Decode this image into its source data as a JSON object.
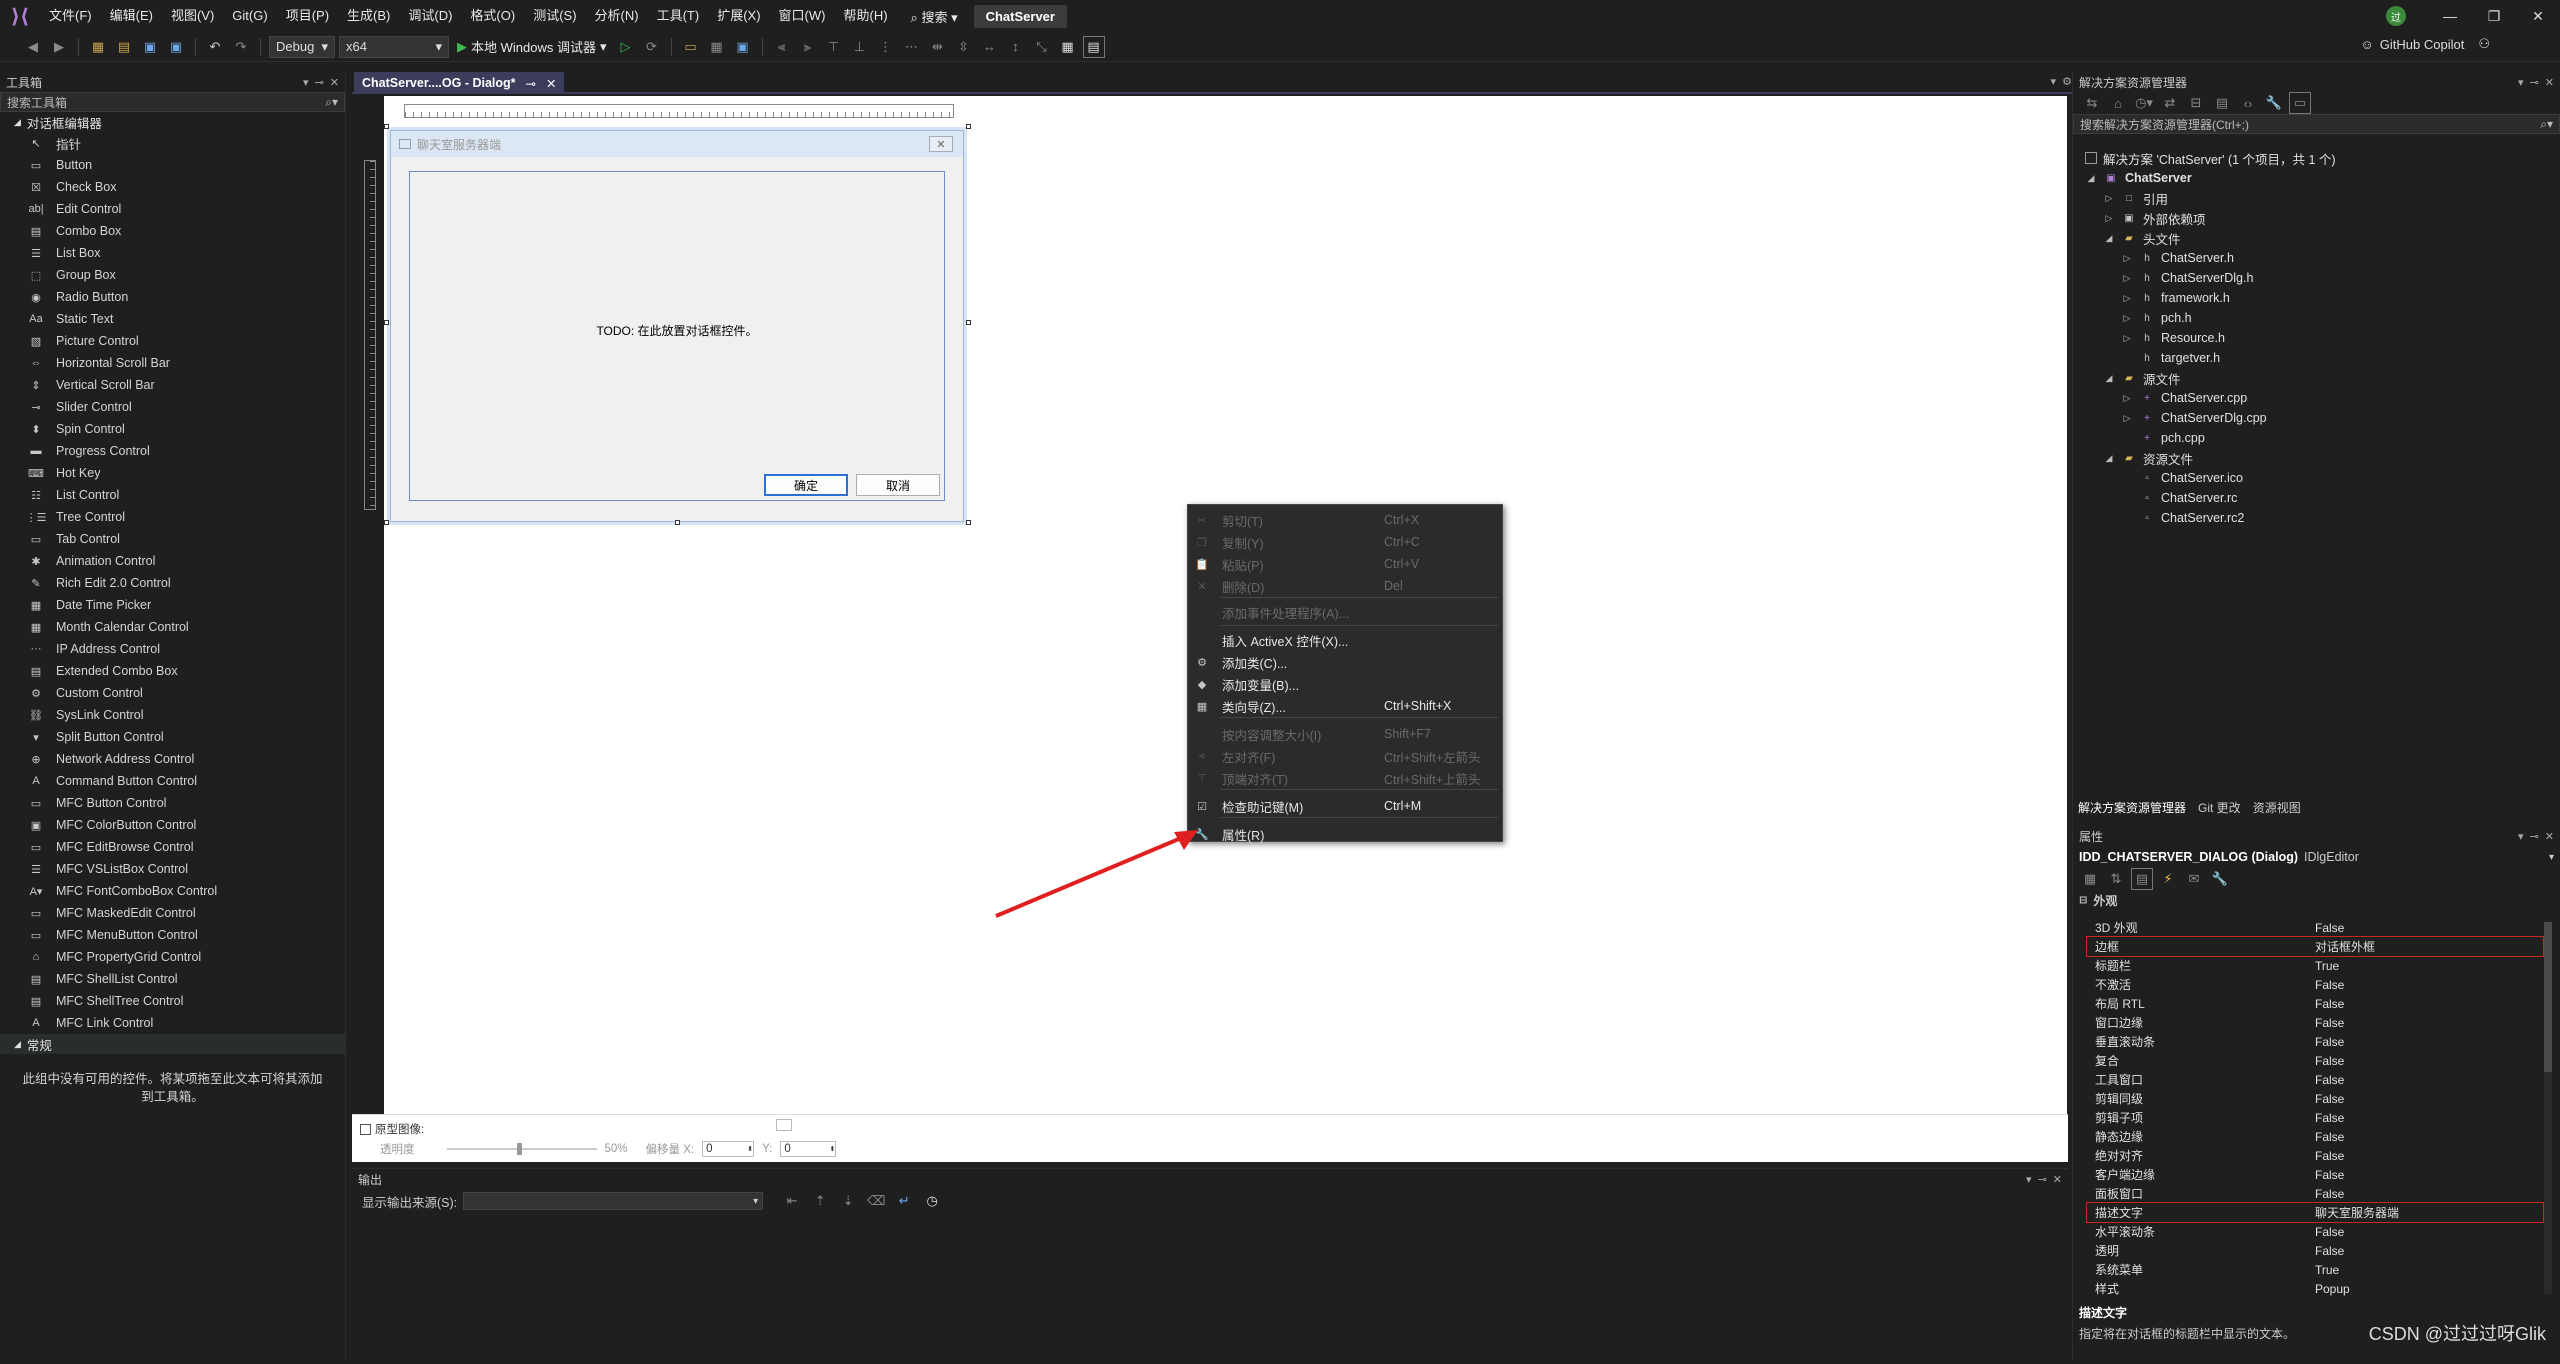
{
  "menubar": {
    "items": [
      "文件(F)",
      "编辑(E)",
      "视图(V)",
      "Git(G)",
      "项目(P)",
      "生成(B)",
      "调试(D)",
      "格式(O)",
      "测试(S)",
      "分析(N)",
      "工具(T)",
      "扩展(X)",
      "窗口(W)",
      "帮助(H)"
    ],
    "search": "搜索",
    "solution_name": "ChatServer",
    "avatar": "过",
    "window_controls": [
      "minimize-icon",
      "restore-icon",
      "close-icon"
    ]
  },
  "toolbar": {
    "config": "Debug",
    "platform": "x64",
    "run_label": "本地 Windows 调试器",
    "copilot": "GitHub Copilot"
  },
  "toolbox": {
    "title": "工具箱",
    "search_placeholder": "搜索工具箱",
    "category": "对话框编辑器",
    "items": [
      "指针",
      "Button",
      "Check Box",
      "Edit Control",
      "Combo Box",
      "List Box",
      "Group Box",
      "Radio Button",
      "Static Text",
      "Picture Control",
      "Horizontal Scroll Bar",
      "Vertical Scroll Bar",
      "Slider Control",
      "Spin Control",
      "Progress Control",
      "Hot Key",
      "List Control",
      "Tree Control",
      "Tab Control",
      "Animation Control",
      "Rich Edit 2.0 Control",
      "Date Time Picker",
      "Month Calendar Control",
      "IP Address Control",
      "Extended Combo Box",
      "Custom Control",
      "SysLink Control",
      "Split Button Control",
      "Network Address Control",
      "Command Button Control",
      "MFC Button Control",
      "MFC ColorButton Control",
      "MFC EditBrowse Control",
      "MFC VSListBox Control",
      "MFC FontComboBox Control",
      "MFC MaskedEdit Control",
      "MFC MenuButton Control",
      "MFC PropertyGrid Control",
      "MFC ShellList Control",
      "MFC ShellTree Control",
      "MFC Link Control"
    ],
    "general_category": "常规",
    "general_note": "此组中没有可用的控件。将某项拖至此文本可将其添加到工具箱。"
  },
  "editor": {
    "tab_label": "ChatServer....OG - Dialog*",
    "dialog_caption": "聊天室服务器端",
    "todo_text": "TODO: 在此放置对话框控件。",
    "ok_label": "确定",
    "cancel_label": "取消"
  },
  "context_menu": {
    "items": [
      {
        "label": "剪切(T)",
        "shortcut": "Ctrl+X",
        "enabled": false,
        "icon": "cut-icon"
      },
      {
        "label": "复制(Y)",
        "shortcut": "Ctrl+C",
        "enabled": false,
        "icon": "copy-icon"
      },
      {
        "label": "粘贴(P)",
        "shortcut": "Ctrl+V",
        "enabled": false,
        "icon": "paste-icon"
      },
      {
        "label": "删除(D)",
        "shortcut": "Del",
        "enabled": false,
        "icon": "delete-icon"
      },
      {
        "label": "添加事件处理程序(A)...",
        "shortcut": "",
        "enabled": false,
        "icon": ""
      },
      {
        "label": "插入 ActiveX 控件(X)...",
        "shortcut": "",
        "enabled": true,
        "icon": ""
      },
      {
        "label": "添加类(C)...",
        "shortcut": "",
        "enabled": true,
        "icon": "add-class-icon"
      },
      {
        "label": "添加变量(B)...",
        "shortcut": "",
        "enabled": true,
        "icon": "add-variable-icon"
      },
      {
        "label": "类向导(Z)...",
        "shortcut": "Ctrl+Shift+X",
        "enabled": true,
        "icon": "class-wizard-icon"
      },
      {
        "label": "按内容调整大小(I)",
        "shortcut": "Shift+F7",
        "enabled": false,
        "icon": ""
      },
      {
        "label": "左对齐(F)",
        "shortcut": "Ctrl+Shift+左箭头",
        "enabled": false,
        "icon": "align-left-icon"
      },
      {
        "label": "顶端对齐(T)",
        "shortcut": "Ctrl+Shift+上箭头",
        "enabled": false,
        "icon": "align-top-icon"
      },
      {
        "label": "检查助记键(M)",
        "shortcut": "Ctrl+M",
        "enabled": true,
        "icon": "check-icon"
      },
      {
        "label": "属性(R)",
        "shortcut": "",
        "enabled": true,
        "icon": "wrench-icon"
      }
    ]
  },
  "design_bar": {
    "prototype_label": "原型图像:",
    "transparency_label": "透明度",
    "transparency_value": "50%",
    "offset_x_label": "偏移量 X:",
    "offset_x": "0",
    "offset_y_label": "Y:",
    "offset_y": "0"
  },
  "output": {
    "title": "输出",
    "source_label": "显示输出来源(S):"
  },
  "solution_explorer": {
    "title": "解决方案资源管理器",
    "search_placeholder": "搜索解决方案资源管理器(Ctrl+;)",
    "solution": "解决方案 'ChatServer' (1 个项目，共 1 个)",
    "project": "ChatServer",
    "nodes": [
      {
        "label": "引用",
        "level": 2,
        "twisty": "▷",
        "icon": "□"
      },
      {
        "label": "外部依赖项",
        "level": 2,
        "twisty": "▷",
        "icon": "▣"
      },
      {
        "label": "头文件",
        "level": 2,
        "twisty": "◢",
        "icon": "▰"
      },
      {
        "label": "ChatServer.h",
        "level": 3,
        "twisty": "▷",
        "icon": "h"
      },
      {
        "label": "ChatServerDlg.h",
        "level": 3,
        "twisty": "▷",
        "icon": "h"
      },
      {
        "label": "framework.h",
        "level": 3,
        "twisty": "▷",
        "icon": "h"
      },
      {
        "label": "pch.h",
        "level": 3,
        "twisty": "▷",
        "icon": "h"
      },
      {
        "label": "Resource.h",
        "level": 3,
        "twisty": "▷",
        "icon": "h"
      },
      {
        "label": "targetver.h",
        "level": 3,
        "twisty": "",
        "icon": "h"
      },
      {
        "label": "源文件",
        "level": 2,
        "twisty": "◢",
        "icon": "▰"
      },
      {
        "label": "ChatServer.cpp",
        "level": 3,
        "twisty": "▷",
        "icon": "+"
      },
      {
        "label": "ChatServerDlg.cpp",
        "level": 3,
        "twisty": "▷",
        "icon": "+"
      },
      {
        "label": "pch.cpp",
        "level": 3,
        "twisty": "",
        "icon": "+"
      },
      {
        "label": "资源文件",
        "level": 2,
        "twisty": "◢",
        "icon": "▰"
      },
      {
        "label": "ChatServer.ico",
        "level": 3,
        "twisty": "",
        "icon": "▫"
      },
      {
        "label": "ChatServer.rc",
        "level": 3,
        "twisty": "",
        "icon": "▫"
      },
      {
        "label": "ChatServer.rc2",
        "level": 3,
        "twisty": "",
        "icon": "▫"
      }
    ],
    "bottom_tabs": [
      "解决方案资源管理器",
      "Git 更改",
      "资源视图"
    ]
  },
  "properties": {
    "title": "属性",
    "object": "IDD_CHATSERVER_DIALOG (Dialog)",
    "object_type": "IDlgEditor",
    "category": "外观",
    "rows": [
      {
        "k": "3D 外观",
        "v": "False",
        "hl": false
      },
      {
        "k": "边框",
        "v": "对话框外框",
        "hl": true
      },
      {
        "k": "标题栏",
        "v": "True",
        "hl": false
      },
      {
        "k": "不激活",
        "v": "False",
        "hl": false
      },
      {
        "k": "布局 RTL",
        "v": "False",
        "hl": false
      },
      {
        "k": "窗口边缘",
        "v": "False",
        "hl": false
      },
      {
        "k": "垂直滚动条",
        "v": "False",
        "hl": false
      },
      {
        "k": "复合",
        "v": "False",
        "hl": false
      },
      {
        "k": "工具窗口",
        "v": "False",
        "hl": false
      },
      {
        "k": "剪辑同级",
        "v": "False",
        "hl": false
      },
      {
        "k": "剪辑子项",
        "v": "False",
        "hl": false
      },
      {
        "k": "静态边缘",
        "v": "False",
        "hl": false
      },
      {
        "k": "绝对对齐",
        "v": "False",
        "hl": false
      },
      {
        "k": "客户端边缘",
        "v": "False",
        "hl": false
      },
      {
        "k": "面板窗口",
        "v": "False",
        "hl": false
      },
      {
        "k": "描述文字",
        "v": "聊天室服务器端",
        "hl": true
      },
      {
        "k": "水平滚动条",
        "v": "False",
        "hl": false
      },
      {
        "k": "透明",
        "v": "False",
        "hl": false
      },
      {
        "k": "系统菜单",
        "v": "True",
        "hl": false
      },
      {
        "k": "样式",
        "v": "Popup",
        "hl": false
      }
    ],
    "desc_title": "描述文字",
    "desc_text": "指定将在对话框的标题栏中显示的文本。"
  },
  "watermark": "CSDN @过过过呀Glik",
  "colors": {
    "accent": "#3c3c5c",
    "highlight": "#c42b1c",
    "arrow": "#e02020"
  }
}
